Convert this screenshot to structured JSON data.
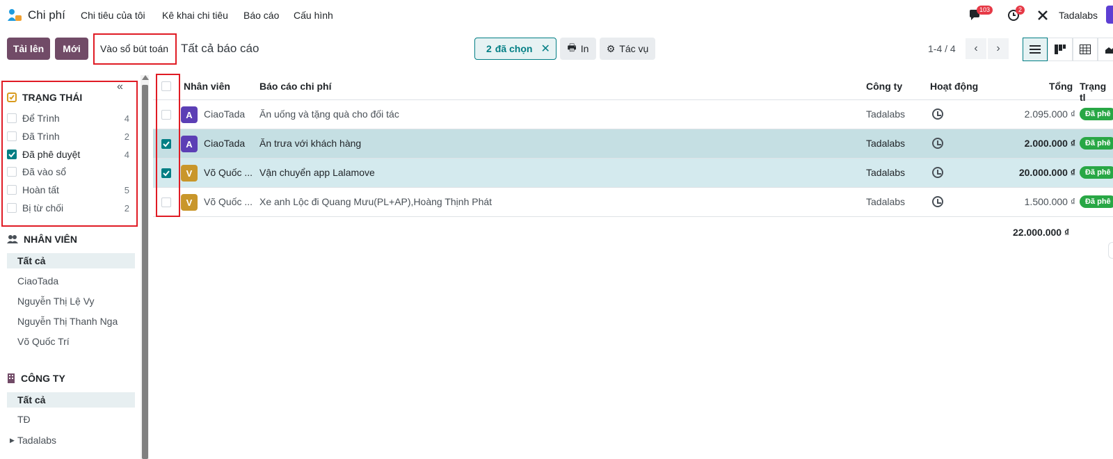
{
  "nav": {
    "app_name": "Chi phí",
    "menu": [
      "Chi tiêu của tôi",
      "Kê khai chi tiêu",
      "Báo cáo",
      "Cấu hình"
    ],
    "messages_badge": "103",
    "activities_badge": "2",
    "company": "Tadalabs"
  },
  "toolbar": {
    "upload_label": "Tải lên",
    "new_label": "Mới",
    "post_label": "Vào sổ bút toán",
    "breadcrumb": "Tất cả báo cáo",
    "selected_count": "2",
    "selected_label": "đã chọn",
    "print_label": "In",
    "action_label": "Tác vụ",
    "pager": "1-4 / 4"
  },
  "sidebar": {
    "status_title": "TRẠNG THÁI",
    "status_items": [
      {
        "label": "Để Trình",
        "count": "4",
        "checked": false
      },
      {
        "label": "Đã Trình",
        "count": "2",
        "checked": false
      },
      {
        "label": "Đã phê duyệt",
        "count": "4",
        "checked": true
      },
      {
        "label": "Đã vào sổ",
        "count": "",
        "checked": false
      },
      {
        "label": "Hoàn tất",
        "count": "5",
        "checked": false
      },
      {
        "label": "Bị từ chối",
        "count": "2",
        "checked": false
      }
    ],
    "employee_title": "NHÂN VIÊN",
    "employees": [
      "Tất cả",
      "CiaoTada",
      "Nguyễn Thị Lệ Vy",
      "Nguyễn Thị Thanh Nga",
      "Võ Quốc Trí"
    ],
    "company_title": "CÔNG TY",
    "companies": [
      "Tất cả",
      "TĐ",
      "Tadalabs"
    ]
  },
  "table": {
    "headers": [
      "Nhân viên",
      "Báo cáo chi phí",
      "Công ty",
      "Hoạt động",
      "Tổng",
      "Trạng tl"
    ],
    "rows": [
      {
        "initial": "A",
        "employee": "CiaoTada",
        "report": "Ăn uống và tặng quà cho đối tác",
        "company": "Tadalabs",
        "total": "2.095.000 ₫",
        "status": "Đã phê",
        "checked": false
      },
      {
        "initial": "A",
        "employee": "CiaoTada",
        "report": "Ăn trưa với khách hàng",
        "company": "Tadalabs",
        "total": "2.000.000 ₫",
        "status": "Đã phê",
        "checked": true
      },
      {
        "initial": "V",
        "employee": "Võ Quốc ...",
        "report": "Vận chuyển app Lalamove",
        "company": "Tadalabs",
        "total": "20.000.000 ₫",
        "status": "Đã phê",
        "checked": true
      },
      {
        "initial": "V",
        "employee": "Võ Quốc ...",
        "report": "Xe anh Lộc đi Quang Mưu(PL+AP),Hoàng Thịnh Phát",
        "company": "Tadalabs",
        "total": "1.500.000 ₫",
        "status": "Đã phê",
        "checked": false
      }
    ],
    "grand_total": "22.000.000 ₫"
  },
  "colors": {
    "brand": "#714b67",
    "accent": "#017e84",
    "status_green": "#28a745",
    "highlight_box": "#e01b24"
  }
}
